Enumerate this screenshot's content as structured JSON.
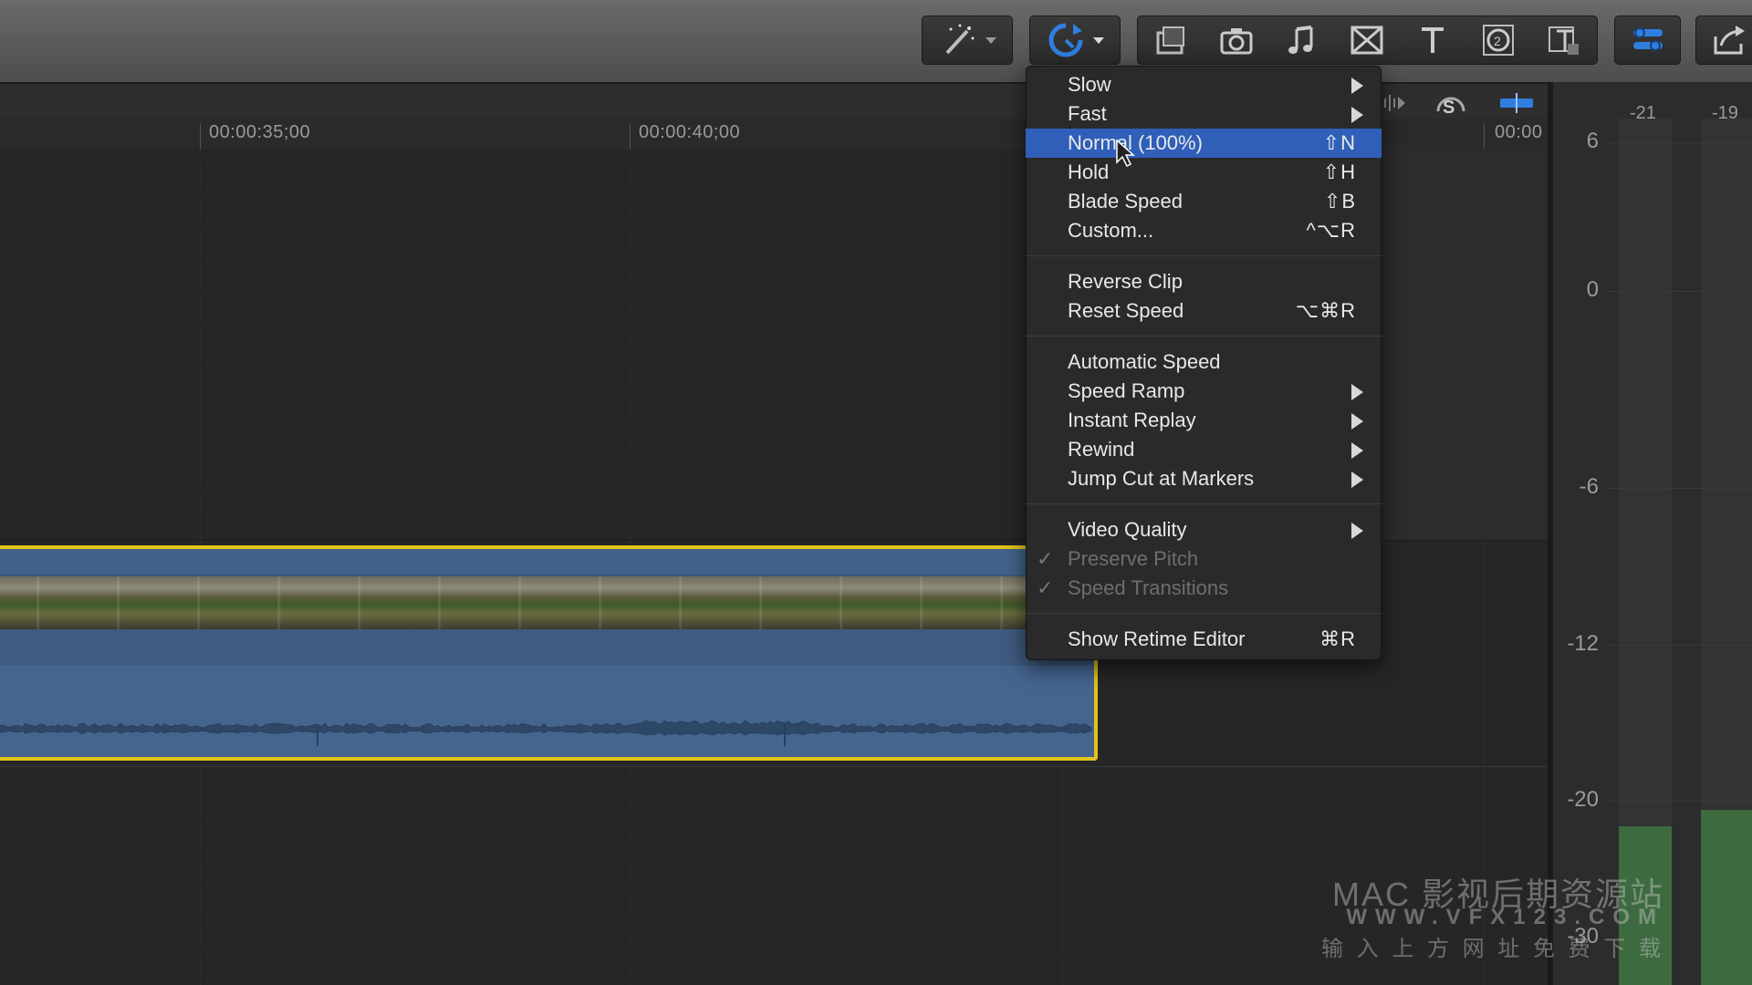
{
  "toolbar": {
    "buttons": [
      {
        "name": "enhancements-button",
        "icon": "magic-wand-icon"
      },
      {
        "name": "retime-button",
        "icon": "retime-icon"
      },
      {
        "name": "effects-browser-button",
        "icon": "effects-icon"
      },
      {
        "name": "photos-browser-button",
        "icon": "camera-icon"
      },
      {
        "name": "music-browser-button",
        "icon": "music-note-icon"
      },
      {
        "name": "transitions-browser-button",
        "icon": "transitions-icon"
      },
      {
        "name": "titles-browser-button",
        "icon": "title-t-icon"
      },
      {
        "name": "generators-browser-button",
        "icon": "generators-icon"
      },
      {
        "name": "themes-browser-button",
        "icon": "themes-icon"
      },
      {
        "name": "inspector-button",
        "icon": "inspector-icon"
      },
      {
        "name": "share-button",
        "icon": "share-icon"
      }
    ],
    "accent": "#2f7fe0"
  },
  "ruler": {
    "timecodes": [
      "00:00:35;00",
      "00:00:40;00",
      "00:00"
    ]
  },
  "meters": {
    "channel_peaks": [
      "-21",
      "-19"
    ],
    "scale": [
      "6",
      "0",
      "-6",
      "-12",
      "-20",
      "-30"
    ]
  },
  "retime_menu": {
    "items": [
      {
        "label": "Slow",
        "shortcut": "",
        "submenu": true
      },
      {
        "label": "Fast",
        "shortcut": "",
        "submenu": true
      },
      {
        "label": "Normal (100%)",
        "shortcut": "⇧N",
        "highlighted": true
      },
      {
        "label": "Hold",
        "shortcut": "⇧H"
      },
      {
        "label": "Blade Speed",
        "shortcut": "⇧B"
      },
      {
        "label": "Custom...",
        "shortcut": "^⌥R"
      },
      {
        "label": "Reverse Clip",
        "shortcut": ""
      },
      {
        "label": "Reset Speed",
        "shortcut": "⌥⌘R"
      },
      {
        "label": "Automatic Speed",
        "shortcut": ""
      },
      {
        "label": "Speed Ramp",
        "shortcut": "",
        "submenu": true
      },
      {
        "label": "Instant Replay",
        "shortcut": "",
        "submenu": true
      },
      {
        "label": "Rewind",
        "shortcut": "",
        "submenu": true
      },
      {
        "label": "Jump Cut at Markers",
        "shortcut": "",
        "submenu": true
      },
      {
        "label": "Video Quality",
        "shortcut": "",
        "submenu": true
      },
      {
        "label": "Preserve Pitch",
        "shortcut": "",
        "checked": true,
        "disabled": true
      },
      {
        "label": "Speed Transitions",
        "shortcut": "",
        "checked": true,
        "disabled": true
      },
      {
        "label": "Show Retime Editor",
        "shortcut": "⌘R"
      }
    ],
    "highlight_color": "#2f5fb8"
  },
  "watermark": {
    "line1": "MAC 影视后期资源站",
    "line2": "WWW.VFX123.COM",
    "line3": "输 入 上 方 网 址   免 费 下 载"
  }
}
